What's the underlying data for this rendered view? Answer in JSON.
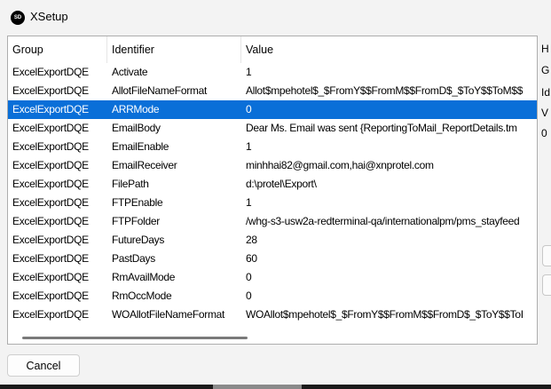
{
  "window": {
    "title": "XSetup",
    "icon_text": "SD"
  },
  "grid": {
    "columns": [
      "Group",
      "Identifier",
      "Value"
    ],
    "selected_index": 2,
    "rows": [
      {
        "group": "ExcelExportDQE",
        "identifier": "Activate",
        "value": "1"
      },
      {
        "group": "ExcelExportDQE",
        "identifier": "AllotFileNameFormat",
        "value": "Allot$mpehotel$_$FromY$$FromM$$FromD$_$ToY$$ToM$$"
      },
      {
        "group": "ExcelExportDQE",
        "identifier": "ARRMode",
        "value": "0"
      },
      {
        "group": "ExcelExportDQE",
        "identifier": "EmailBody",
        "value": "Dear Ms.  Email was sent  {ReportingToMail_ReportDetails.tm"
      },
      {
        "group": "ExcelExportDQE",
        "identifier": "EmailEnable",
        "value": "1"
      },
      {
        "group": "ExcelExportDQE",
        "identifier": "EmailReceiver",
        "value": "minhhai82@gmail.com,hai@xnprotel.com"
      },
      {
        "group": "ExcelExportDQE",
        "identifier": "FilePath",
        "value": "d:\\protel\\Export\\"
      },
      {
        "group": "ExcelExportDQE",
        "identifier": "FTPEnable",
        "value": "1"
      },
      {
        "group": "ExcelExportDQE",
        "identifier": "FTPFolder",
        "value": "/whg-s3-usw2a-redterminal-qa/internationalpm/pms_stayfeed"
      },
      {
        "group": "ExcelExportDQE",
        "identifier": "FutureDays",
        "value": "28"
      },
      {
        "group": "ExcelExportDQE",
        "identifier": "PastDays",
        "value": "60"
      },
      {
        "group": "ExcelExportDQE",
        "identifier": "RmAvailMode",
        "value": "0"
      },
      {
        "group": "ExcelExportDQE",
        "identifier": "RmOccMode",
        "value": "0"
      },
      {
        "group": "ExcelExportDQE",
        "identifier": "WOAllotFileNameFormat",
        "value": "WOAllot$mpehotel$_$FromY$$FromM$$FromD$_$ToY$$ToI"
      }
    ]
  },
  "side_panel": {
    "labels": [
      "H",
      "G",
      "Id",
      "V",
      "0"
    ]
  },
  "footer": {
    "cancel_label": "Cancel"
  },
  "colors": {
    "selection": "#0a6fd8",
    "window_bg": "#f3f3f3"
  }
}
